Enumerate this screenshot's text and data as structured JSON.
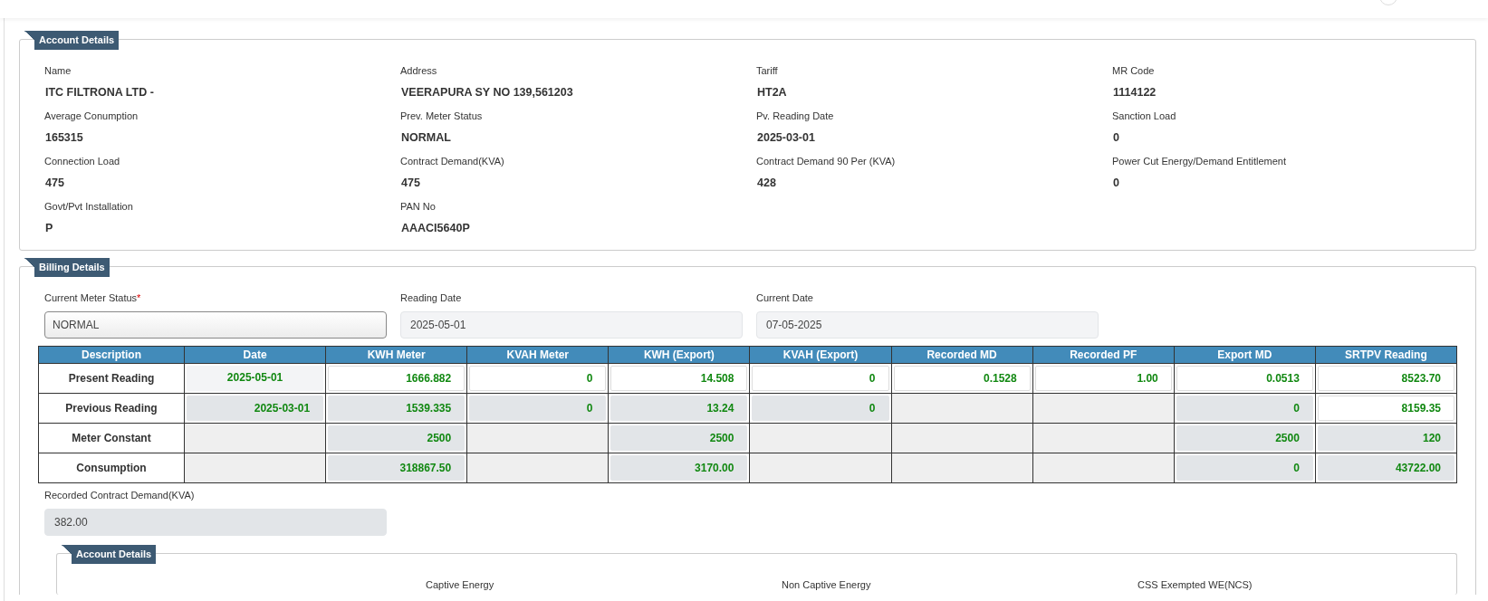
{
  "account_details": {
    "title": "Account Details",
    "fields": [
      {
        "label": "Name",
        "value": "ITC FILTRONA LTD -"
      },
      {
        "label": "Address",
        "value": "VEERAPURA SY NO 139,561203"
      },
      {
        "label": "Tariff",
        "value": "HT2A"
      },
      {
        "label": "MR Code",
        "value": "1114122"
      },
      {
        "label": "Average Conumption",
        "value": "165315"
      },
      {
        "label": "Prev. Meter Status",
        "value": "NORMAL"
      },
      {
        "label": "Pv. Reading Date",
        "value": "2025-03-01"
      },
      {
        "label": "Sanction Load",
        "value": "0"
      },
      {
        "label": "Connection Load",
        "value": "475"
      },
      {
        "label": "Contract Demand(KVA)",
        "value": "475"
      },
      {
        "label": "Contract Demand 90 Per (KVA)",
        "value": "428"
      },
      {
        "label": "Power Cut Energy/Demand Entitlement",
        "value": "0"
      },
      {
        "label": "Govt/Pvt Installation",
        "value": "P"
      },
      {
        "label": "PAN No",
        "value": "AAACI5640P"
      }
    ]
  },
  "billing_details": {
    "title": "Billing Details",
    "fields": [
      {
        "label": "Current Meter Status",
        "required_mark": "*",
        "kind": "select",
        "value": "NORMAL"
      },
      {
        "label": "Reading Date",
        "kind": "readonly",
        "value": "2025-05-01"
      },
      {
        "label": "Current Date",
        "kind": "readonly",
        "value": "07-05-2025"
      }
    ],
    "table": {
      "columns": [
        "Description",
        "Date",
        "KWH Meter",
        "KVAH Meter",
        "KWH (Export)",
        "KVAH (Export)",
        "Recorded MD",
        "Recorded PF",
        "Export MD",
        "SRTPV Reading"
      ],
      "rows": [
        {
          "cells": [
            {
              "kind": "label",
              "value": "Present Reading"
            },
            {
              "kind": "readonly-light",
              "value": "2025-05-01"
            },
            {
              "kind": "input",
              "value": "1666.882"
            },
            {
              "kind": "input",
              "value": "0"
            },
            {
              "kind": "input",
              "value": "14.508"
            },
            {
              "kind": "input",
              "value": "0"
            },
            {
              "kind": "input",
              "value": "0.1528"
            },
            {
              "kind": "input",
              "value": "1.00"
            },
            {
              "kind": "input",
              "value": "0.0513"
            },
            {
              "kind": "input",
              "value": "8523.70"
            }
          ]
        },
        {
          "cells": [
            {
              "kind": "label",
              "value": "Previous Reading"
            },
            {
              "kind": "readonly",
              "value": "2025-03-01"
            },
            {
              "kind": "readonly",
              "value": "1539.335"
            },
            {
              "kind": "readonly",
              "value": "0"
            },
            {
              "kind": "readonly",
              "value": "13.24"
            },
            {
              "kind": "readonly",
              "value": "0"
            },
            {
              "kind": "empty"
            },
            {
              "kind": "empty"
            },
            {
              "kind": "readonly",
              "value": "0"
            },
            {
              "kind": "input",
              "value": "8159.35"
            }
          ]
        },
        {
          "cells": [
            {
              "kind": "label",
              "value": "Meter Constant"
            },
            {
              "kind": "empty"
            },
            {
              "kind": "readonly",
              "value": "2500"
            },
            {
              "kind": "empty"
            },
            {
              "kind": "readonly",
              "value": "2500"
            },
            {
              "kind": "empty"
            },
            {
              "kind": "empty"
            },
            {
              "kind": "empty"
            },
            {
              "kind": "readonly",
              "value": "2500"
            },
            {
              "kind": "readonly",
              "value": "120"
            }
          ]
        },
        {
          "cells": [
            {
              "kind": "label",
              "value": "Consumption"
            },
            {
              "kind": "empty"
            },
            {
              "kind": "readonly",
              "value": "318867.50"
            },
            {
              "kind": "empty"
            },
            {
              "kind": "readonly",
              "value": "3170.00"
            },
            {
              "kind": "empty"
            },
            {
              "kind": "empty"
            },
            {
              "kind": "empty"
            },
            {
              "kind": "readonly",
              "value": "0"
            },
            {
              "kind": "readonly",
              "value": "43722.00"
            }
          ]
        }
      ]
    },
    "recorded_contract_demand": {
      "label": "Recorded Contract Demand(KVA)",
      "value": "382.00"
    }
  },
  "account_details_2": {
    "title": "Account Details",
    "fields": [
      {
        "label": "Captive Energy"
      },
      {
        "label": "Non Captive Energy"
      },
      {
        "label": "CSS Exempted WE(NCS)"
      }
    ]
  }
}
